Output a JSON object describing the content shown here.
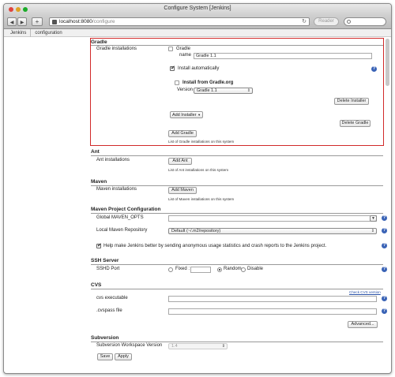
{
  "browser": {
    "title": "Configure System [Jenkins]",
    "url_host": "localhost:8080",
    "url_path": "/configure",
    "reader_label": "Reader",
    "back_glyph": "◀",
    "forward_glyph": "▶",
    "add_glyph": "+",
    "reload_glyph": "↻"
  },
  "breadcrumbs": [
    "Jenkins",
    "configuration"
  ],
  "gradle": {
    "heading": "Gradle",
    "installations_label": "Gradle installations",
    "gradle_checkbox_label": "Gradle",
    "name_label": "name",
    "name_value": "Gradle 1.1",
    "install_auto_label": "Install automatically",
    "install_from_label": "Install from Gradle.org",
    "version_label": "Version",
    "version_value": "Gradle 1.1",
    "delete_installer": "Delete Installer",
    "add_installer": "Add Installer",
    "delete_gradle": "Delete Gradle",
    "add_gradle": "Add Gradle",
    "list_note": "List of Gradle installations on this system"
  },
  "ant": {
    "heading": "Ant",
    "installations_label": "Ant installations",
    "add_button": "Add Ant",
    "list_note": "List of Ant installations on this system"
  },
  "maven": {
    "heading": "Maven",
    "installations_label": "Maven installations",
    "add_button": "Add Maven",
    "list_note": "List of Maven installations on this system"
  },
  "maven_project": {
    "heading": "Maven Project Configuration",
    "global_opts_label": "Global MAVEN_OPTS",
    "global_opts_value": "",
    "local_repo_label": "Local Maven Repository",
    "local_repo_value": "Default (~/.m2/repository)",
    "stats_label": "Help make Jenkins better by sending anonymous usage statistics and crash reports to the Jenkins project."
  },
  "ssh": {
    "heading": "SSH Server",
    "port_label": "SSHD Port",
    "fixed_label": "Fixed :",
    "random_label": "Random",
    "disable_label": "Disable"
  },
  "cvs": {
    "heading": "CVS",
    "check_link": "Check CVS version",
    "exe_label": "cvs executable",
    "exe_value": "",
    "cvspass_label": ".cvspass file",
    "cvspass_value": "",
    "advanced_button": "Advanced..."
  },
  "subversion": {
    "heading": "Subversion",
    "ws_version_label": "Subversion Workspace Version",
    "ws_version_value": "1.4"
  },
  "footer": {
    "save": "Save",
    "apply": "Apply"
  },
  "icons": {
    "help": "?",
    "dropdown_arrow": "▼",
    "select_arrows": "⇕"
  },
  "colors": {
    "highlight_border": "#d12a2a",
    "help_icon": "#3a63b6",
    "link": "#2b53a8"
  }
}
